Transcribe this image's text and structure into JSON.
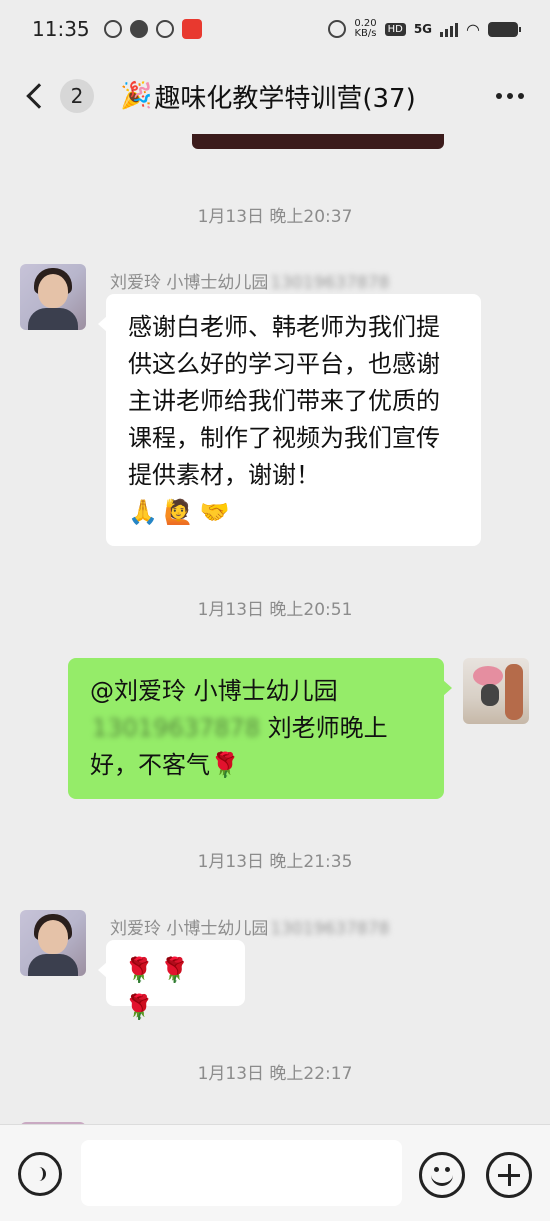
{
  "status_bar": {
    "time": "11:35",
    "net_speed_value": "0.20",
    "net_speed_unit": "KB/s",
    "hd_label": "HD",
    "network_label": "5G",
    "icons": [
      "k-circle-icon",
      "chat-bubble-icon",
      "leaf-icon",
      "app-icon",
      "alarm-icon",
      "signal-icon",
      "wifi-icon",
      "battery-icon"
    ]
  },
  "header": {
    "back_badge": "2",
    "title_emoji": "🎉",
    "title": "趣味化教学特训营(37)"
  },
  "messages": [
    {
      "timestamp": "1月13日 晚上20:37",
      "sender": "刘爱玲  小博士幼儿园",
      "sender_phone": "13019637878",
      "text": "感谢白老师、韩老师为我们提供这么好的学习平台，也感谢主讲老师给我们带来了优质的课程，制作了视频为我们宣传提供素材，谢谢！",
      "emojis": "🙏🙋🤝"
    },
    {
      "timestamp": "1月13日 晚上20:51",
      "mention": "@刘爱玲  小博士幼儿园",
      "mention_phone": "13019637878",
      "text": " 刘老师晚上好，不客气",
      "emoji": "🌹"
    },
    {
      "timestamp": "1月13日 晚上21:35",
      "sender": "刘爱玲  小博士幼儿园",
      "sender_phone": "13019637878",
      "emojis": "🌹🌹🌹"
    },
    {
      "timestamp": "1月13日 晚上22:17"
    }
  ],
  "input_bar": {
    "value": "",
    "placeholder": ""
  },
  "colors": {
    "background": "#ededed",
    "self_bubble": "#95ec69",
    "other_bubble": "#ffffff",
    "timestamp": "#8c8c8c"
  }
}
